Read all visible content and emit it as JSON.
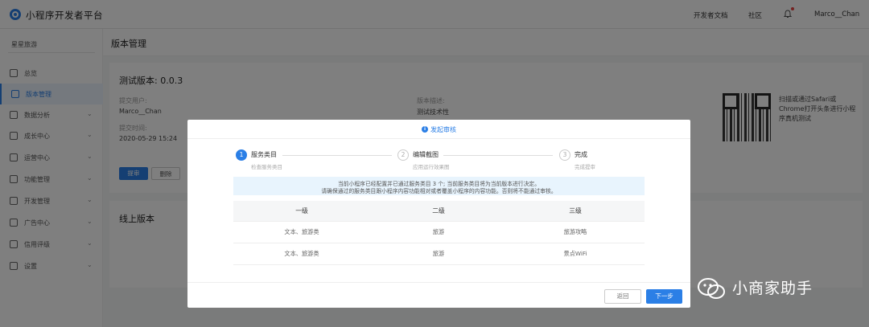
{
  "app": {
    "title": "小程序开发者平台"
  },
  "topnav": {
    "docs": "开发者文档",
    "community": "社区",
    "user": "Marco__Chan"
  },
  "sidebar": {
    "project": "星星旅游",
    "items": [
      {
        "label": "总览"
      },
      {
        "label": "版本管理"
      },
      {
        "label": "数据分析"
      },
      {
        "label": "成长中心"
      },
      {
        "label": "运营中心"
      },
      {
        "label": "功能管理"
      },
      {
        "label": "开发管理"
      },
      {
        "label": "广告中心"
      },
      {
        "label": "信用评级"
      },
      {
        "label": "设置"
      }
    ]
  },
  "page": {
    "title": "版本管理"
  },
  "test_version": {
    "title": "测试版本: 0.0.3",
    "submitter_label": "提交用户:",
    "submitter": "Marco__Chan",
    "desc_label": "版本描述:",
    "desc": "测试技术性",
    "time_label": "提交时间:",
    "time": "2020-05-29 15:24",
    "btn_submit": "提审",
    "btn_delete": "删除",
    "qr_tip": "扫描或通过Safari或Chrome打开头条进行小程序真机测试"
  },
  "online_version": {
    "title": "线上版本"
  },
  "modal": {
    "title": "发起审核",
    "steps": [
      {
        "num": "1",
        "title": "服务类目",
        "desc": "检查服务类目"
      },
      {
        "num": "2",
        "title": "编辑截图",
        "desc": "应用运行效果图"
      },
      {
        "num": "3",
        "title": "完成",
        "desc": "完成提审"
      }
    ],
    "notice": [
      "当前小程序已经配置并已通过服务类目 3 个; 当前服务类目将为当前版本进行决定。",
      "请确保通过的服务类目跟小程序内容功能相对或者覆盖小程序的内容功能。否则将不能通过审核。"
    ],
    "table": {
      "headers": [
        "一级",
        "二级",
        "三级"
      ],
      "rows": [
        [
          "文本、旅游类",
          "旅游",
          "旅游攻略"
        ],
        [
          "文本、旅游类",
          "旅游",
          "景点WiFi"
        ]
      ]
    },
    "btn_back": "返回",
    "btn_next": "下一步"
  },
  "watermark": {
    "text": "小商家助手"
  },
  "colors": {
    "primary": "#2b7fe6",
    "notice_bg": "#e8f4fd"
  }
}
